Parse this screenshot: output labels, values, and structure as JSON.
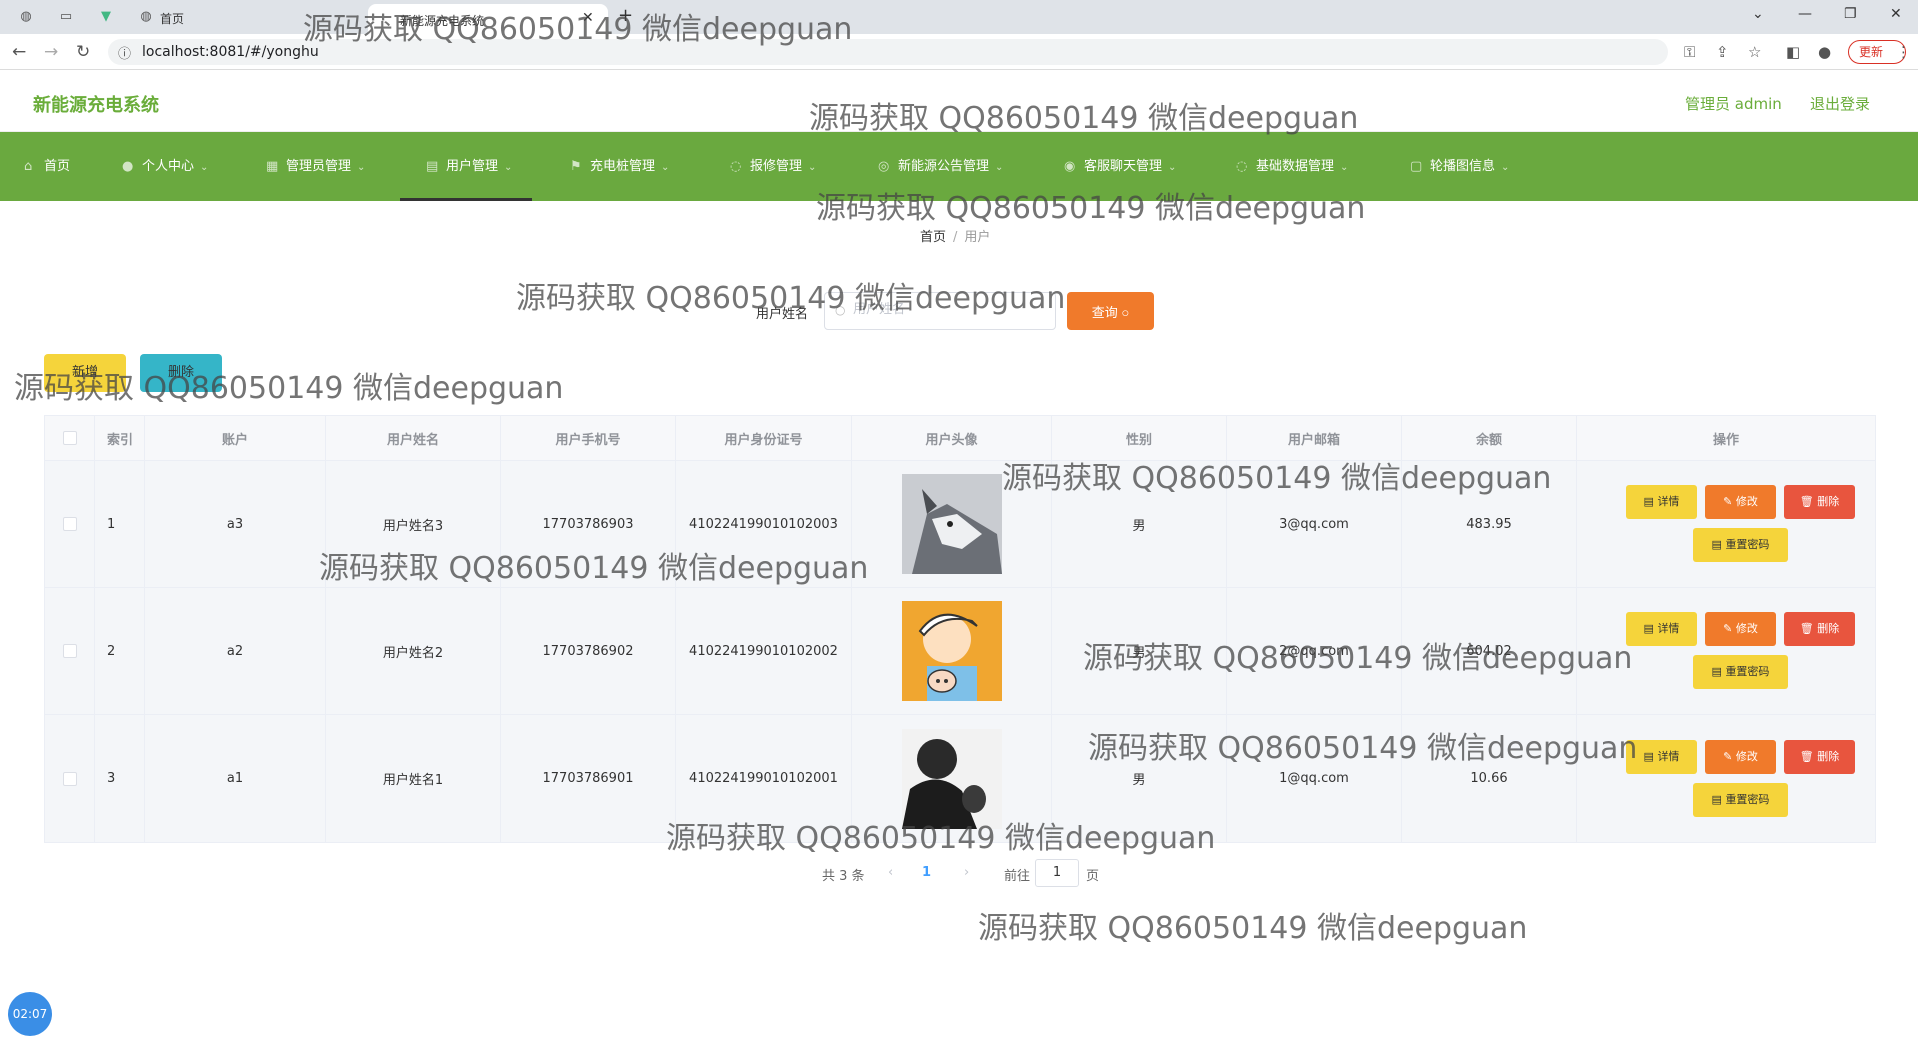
{
  "browser": {
    "tab_title": "首页",
    "active_tab_title": "新能源充电系统",
    "url": "localhost:8081/#/yonghu",
    "update_label": "更新"
  },
  "header": {
    "app_title": "新能源充电系统",
    "admin_label": "管理员 admin",
    "logout_label": "退出登录"
  },
  "nav": {
    "items": [
      {
        "label": "首页",
        "icon": "home-icon"
      },
      {
        "label": "个人中心",
        "icon": "user-icon"
      },
      {
        "label": "管理员管理",
        "icon": "admin-icon"
      },
      {
        "label": "用户管理",
        "icon": "users-icon"
      },
      {
        "label": "充电桩管理",
        "icon": "charger-icon"
      },
      {
        "label": "报修管理",
        "icon": "repair-icon"
      },
      {
        "label": "新能源公告管理",
        "icon": "notice-icon"
      },
      {
        "label": "客服聊天管理",
        "icon": "chat-icon"
      },
      {
        "label": "基础数据管理",
        "icon": "data-icon"
      },
      {
        "label": "轮播图信息",
        "icon": "carousel-icon"
      }
    ]
  },
  "breadcrumb": {
    "home": "首页",
    "separator": "/",
    "current": "用户"
  },
  "search": {
    "label": "用户姓名",
    "placeholder": "用户姓名",
    "value": "",
    "button_label": "查询"
  },
  "actions": {
    "add_label": "新增",
    "delete_label": "删除"
  },
  "table": {
    "headers": [
      "索引",
      "账户",
      "用户姓名",
      "用户手机号",
      "用户身份证号",
      "用户头像",
      "性别",
      "用户邮箱",
      "余额",
      "操作"
    ],
    "rows": [
      {
        "index": "1",
        "account": "a3",
        "name": "用户姓名3",
        "phone": "17703786903",
        "id_card": "410224199010102003",
        "avatar": "husky-photo",
        "gender": "男",
        "email": "3@qq.com",
        "balance": "483.95"
      },
      {
        "index": "2",
        "account": "a2",
        "name": "用户姓名2",
        "phone": "17703786902",
        "id_card": "410224199010102002",
        "avatar": "cartoon-boy",
        "gender": "男",
        "email": "2@qq.com",
        "balance": "604.02"
      },
      {
        "index": "3",
        "account": "a1",
        "name": "用户姓名1",
        "phone": "17703786901",
        "id_card": "410224199010102001",
        "avatar": "bw-portrait",
        "gender": "男",
        "email": "1@qq.com",
        "balance": "10.66"
      }
    ],
    "op_labels": {
      "detail": "详情",
      "edit": "修改",
      "delete": "删除",
      "reset": "重置密码"
    }
  },
  "pagination": {
    "total": "共 3 条",
    "current_page": "1",
    "goto_label": "前往",
    "goto_value": "1",
    "page_unit": "页"
  },
  "watermark": "源码获取 QQ86050149 微信deepguan",
  "timer": "02:07"
}
